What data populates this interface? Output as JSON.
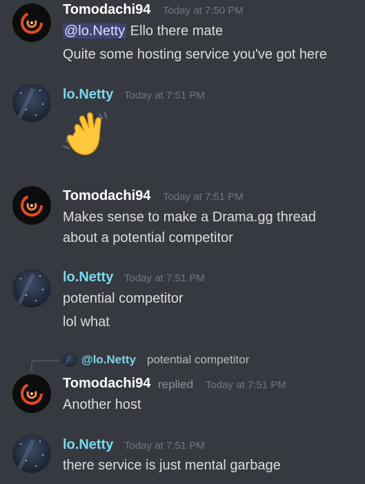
{
  "messages": [
    {
      "author": "Tomodachi94",
      "time": "Today at 7:50 PM",
      "mention": "@lo.Netty",
      "line1_after_mention": " Ello there mate",
      "line2": "Quite some hosting service you've got here"
    },
    {
      "author": "lo.Netty",
      "time": "Today at 7:51 PM",
      "emoji": "waving-hand"
    },
    {
      "author": "Tomodachi94",
      "time": "Today at 7:51 PM",
      "line1": "Makes sense to make a Drama.gg thread",
      "line2": "about a potential competitor"
    },
    {
      "author": "lo.Netty",
      "time": "Today at 7:51 PM",
      "line1": "potential competitor",
      "line2": "lol what"
    },
    {
      "reply_to": {
        "mention": "@lo.Netty",
        "preview": "potential competitor"
      },
      "author": "Tomodachi94",
      "replied_label": "replied",
      "time": "Today at 7:51 PM",
      "line1": "Another host"
    },
    {
      "author": "lo.Netty",
      "time": "Today at 7:51 PM",
      "line1": "there service is just mental garbage"
    }
  ],
  "colors": {
    "background": "#36393f",
    "netty_name": "#7ad9ef",
    "tomo_name": "#ffffff",
    "timestamp": "#72767d",
    "text": "#dcddde",
    "mention_bg": "#5865f2"
  }
}
